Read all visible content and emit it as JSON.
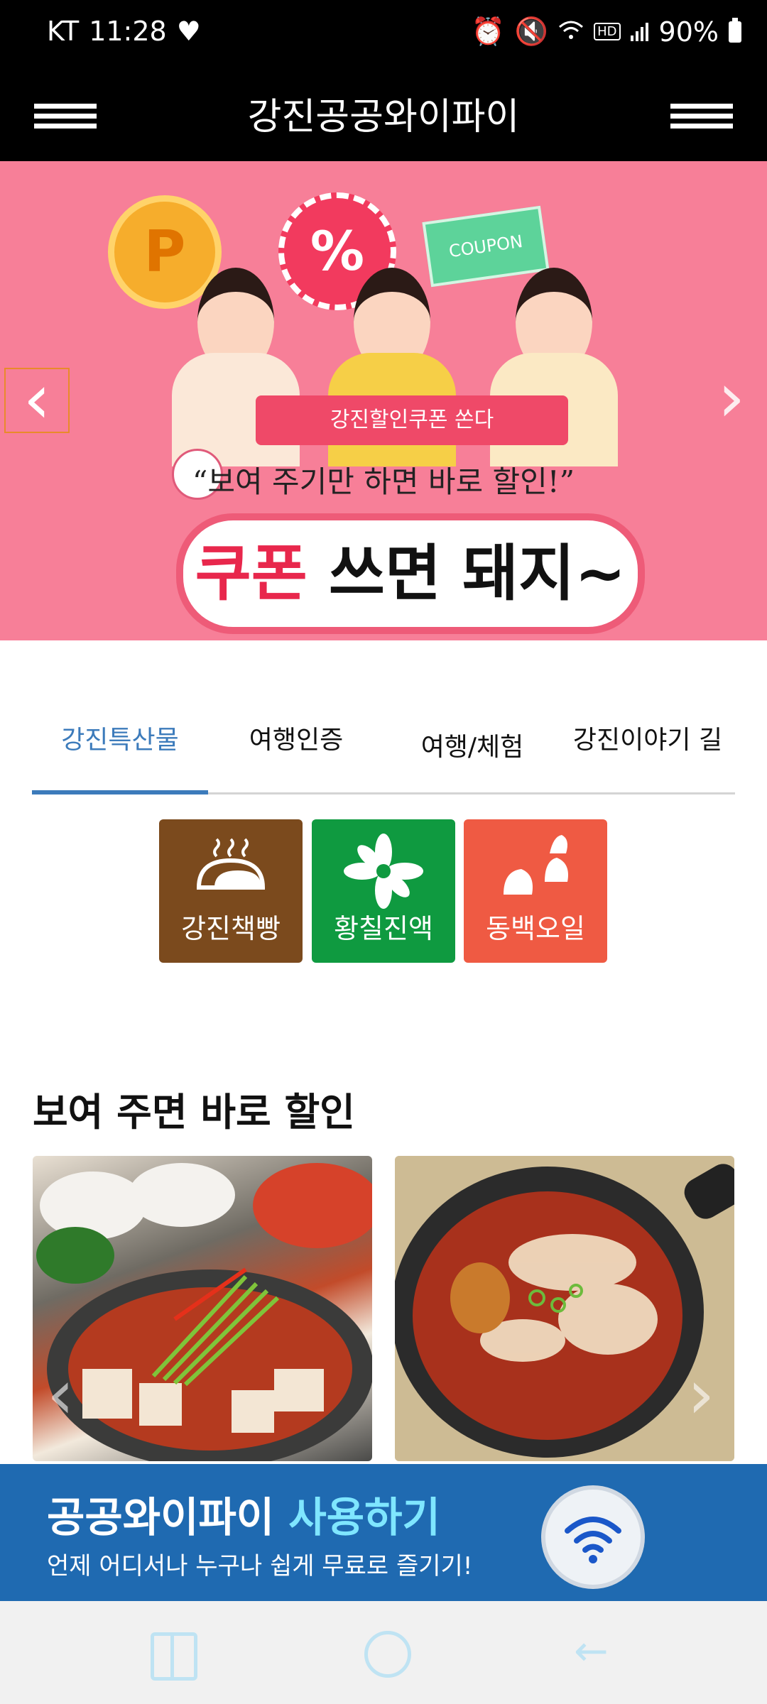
{
  "status_bar": {
    "carrier": "KT",
    "time": "11:28",
    "heart_icon": "heart-icon",
    "hd_label": "HD",
    "battery": "90%"
  },
  "app_bar": {
    "title": "강진공공와이파이"
  },
  "banner": {
    "coin_letter": "P",
    "badge_symbol": "%",
    "coupon_text": "COUPON",
    "ribbon_text": "강진할인쿠폰 쏜다",
    "quote": "“보여 주기만 하면 바로 할인!”",
    "headline_red": "쿠폰",
    "headline_rest": " 쓰면 돼지~",
    "prev_symbol": "‹",
    "next_symbol": "›"
  },
  "tabs": [
    {
      "label": "강진특산물",
      "active": true
    },
    {
      "label": "여행인증",
      "active": false
    },
    {
      "label": "여행/체험",
      "active": false
    },
    {
      "label": "강진이야기 길",
      "active": false
    }
  ],
  "categories": [
    {
      "label": "강진책빵",
      "color": "#7b4a1d",
      "icon": "bread-icon"
    },
    {
      "label": "황칠진액",
      "color": "#0f9a40",
      "icon": "flower-icon"
    },
    {
      "label": "동백오일",
      "color": "#ef5a43",
      "icon": "camellia-icon"
    }
  ],
  "section": {
    "title": "보여 주면 바로 할인"
  },
  "cards": [
    {
      "name": "food-card-stew",
      "icon": "stew-image"
    },
    {
      "name": "food-card-tteokbokki",
      "icon": "tteokbokki-image"
    }
  ],
  "promo": {
    "title_plain": "공공와이파이 ",
    "title_highlight": "사용하기",
    "subtitle": "언제 어디서나 누구나 쉽게 무료로 즐기기!"
  },
  "colors": {
    "header_bg": "#000000",
    "banner_bg": "#f77f98",
    "tab_active": "#3c7bbb",
    "promo_bg": "#1f6ab1"
  }
}
